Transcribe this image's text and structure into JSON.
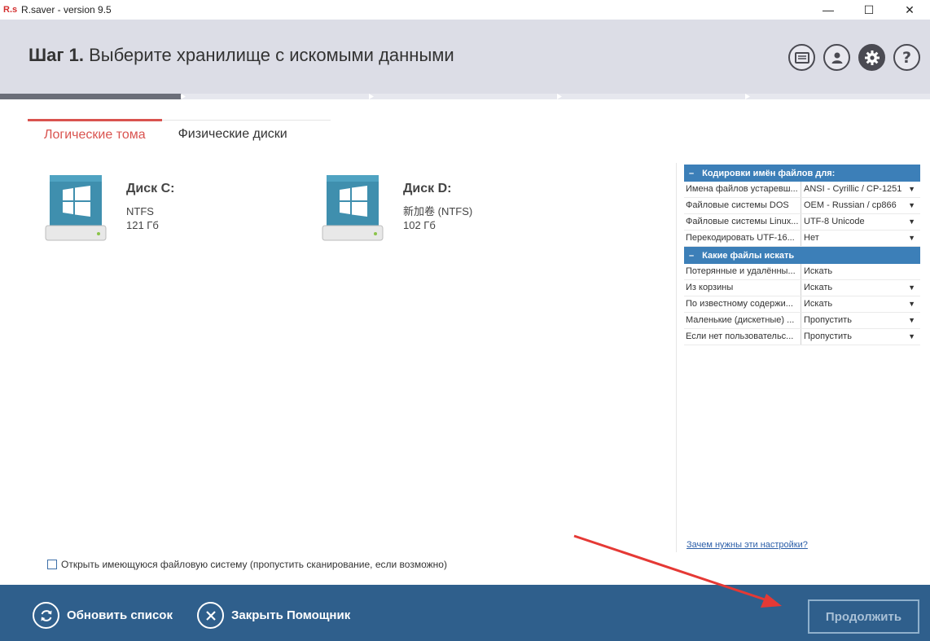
{
  "window": {
    "logo": "R.s",
    "title": "R.saver - version 9.5",
    "minimize": "—",
    "maximize": "☐",
    "close": "✕"
  },
  "header": {
    "step": "Шаг 1.",
    "title": "Выберите хранилище с искомыми данными",
    "icons": [
      "log-icon",
      "user-icon",
      "settings-icon",
      "help-icon"
    ]
  },
  "progress": {
    "fraction": 0.195
  },
  "tabs": [
    {
      "label": "Логические тома",
      "active": true
    },
    {
      "label": "Физические диски",
      "active": false
    }
  ],
  "disks": [
    {
      "name": "Диск C:",
      "fs": "NTFS",
      "size": "121 Гб"
    },
    {
      "name": "Диск D:",
      "fs": "新加卷 (NTFS)",
      "size": "102 Гб"
    }
  ],
  "settings": {
    "encoding_section": "Кодировки имён файлов для:",
    "encoding_rows": [
      {
        "key": "Имена файлов устаревш...",
        "value": "ANSI - Cyrillic / CP-1251",
        "dropdown": true
      },
      {
        "key": "Файловые системы DOS",
        "value": "OEM - Russian / cp866",
        "dropdown": true
      },
      {
        "key": "Файловые системы Linux...",
        "value": "UTF-8 Unicode",
        "dropdown": true
      },
      {
        "key": "Перекодировать UTF-16...",
        "value": "Нет",
        "dropdown": true
      }
    ],
    "search_section": "Какие файлы искать",
    "search_rows": [
      {
        "key": "Потерянные и удалённы...",
        "value": "Искать",
        "dropdown": false
      },
      {
        "key": "Из корзины",
        "value": "Искать",
        "dropdown": true
      },
      {
        "key": "По известному содержи...",
        "value": "Искать",
        "dropdown": true
      },
      {
        "key": "Маленькие (дискетные) ...",
        "value": "Пропустить",
        "dropdown": true
      },
      {
        "key": "Если нет пользовательс...",
        "value": "Пропустить",
        "dropdown": true
      }
    ],
    "help_link": "Зачем нужны эти настройки?"
  },
  "open_fs_label": "Открыть имеющуюся файловую систему (пропустить сканирование, если возможно)",
  "footer": {
    "refresh": "Обновить список",
    "close_wizard": "Закрыть Помощник",
    "continue": "Продолжить"
  },
  "colors": {
    "accent_red": "#d9534f",
    "section_blue": "#3c7fb8",
    "footer_blue": "#2f5f8c",
    "annotation_arrow": "#e53935"
  }
}
